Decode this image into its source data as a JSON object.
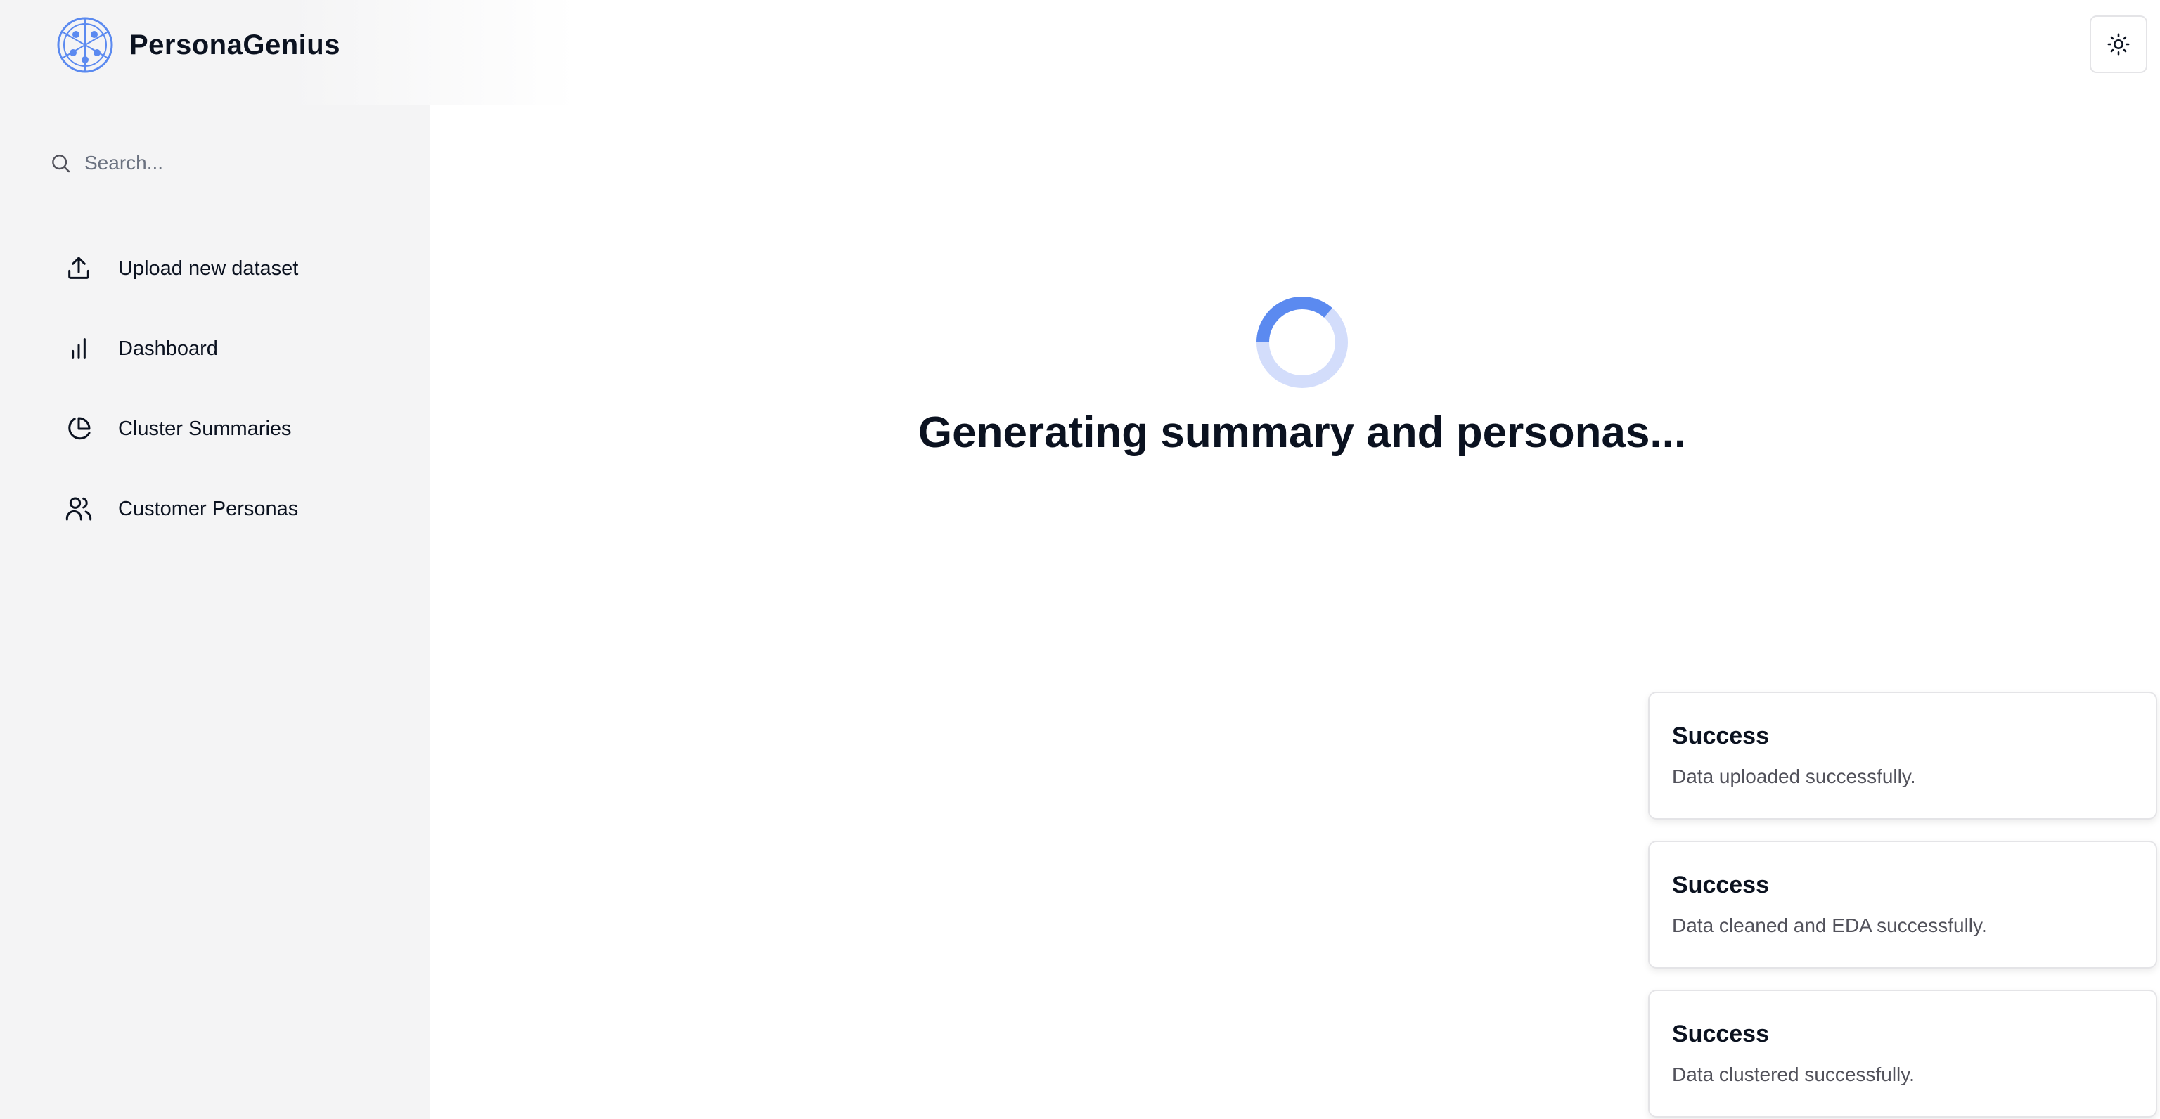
{
  "app": {
    "name": "PersonaGenius"
  },
  "search": {
    "placeholder": "Search..."
  },
  "sidebar": {
    "items": [
      {
        "label": "Upload new dataset",
        "icon": "upload-icon"
      },
      {
        "label": "Dashboard",
        "icon": "bar-chart-icon"
      },
      {
        "label": "Cluster Summaries",
        "icon": "pie-chart-icon"
      },
      {
        "label": "Customer Personas",
        "icon": "users-icon"
      }
    ]
  },
  "header": {
    "theme_toggle_icon": "sun-icon"
  },
  "main": {
    "loading_text": "Generating summary and personas..."
  },
  "toasts": [
    {
      "title": "Success",
      "message": "Data uploaded successfully."
    },
    {
      "title": "Success",
      "message": "Data cleaned and EDA successfully."
    },
    {
      "title": "Success",
      "message": "Data clustered successfully."
    }
  ],
  "colors": {
    "accent": "#5b8af0",
    "accent_light": "#d3ddfb",
    "sidebar_bg": "#f4f4f5"
  }
}
